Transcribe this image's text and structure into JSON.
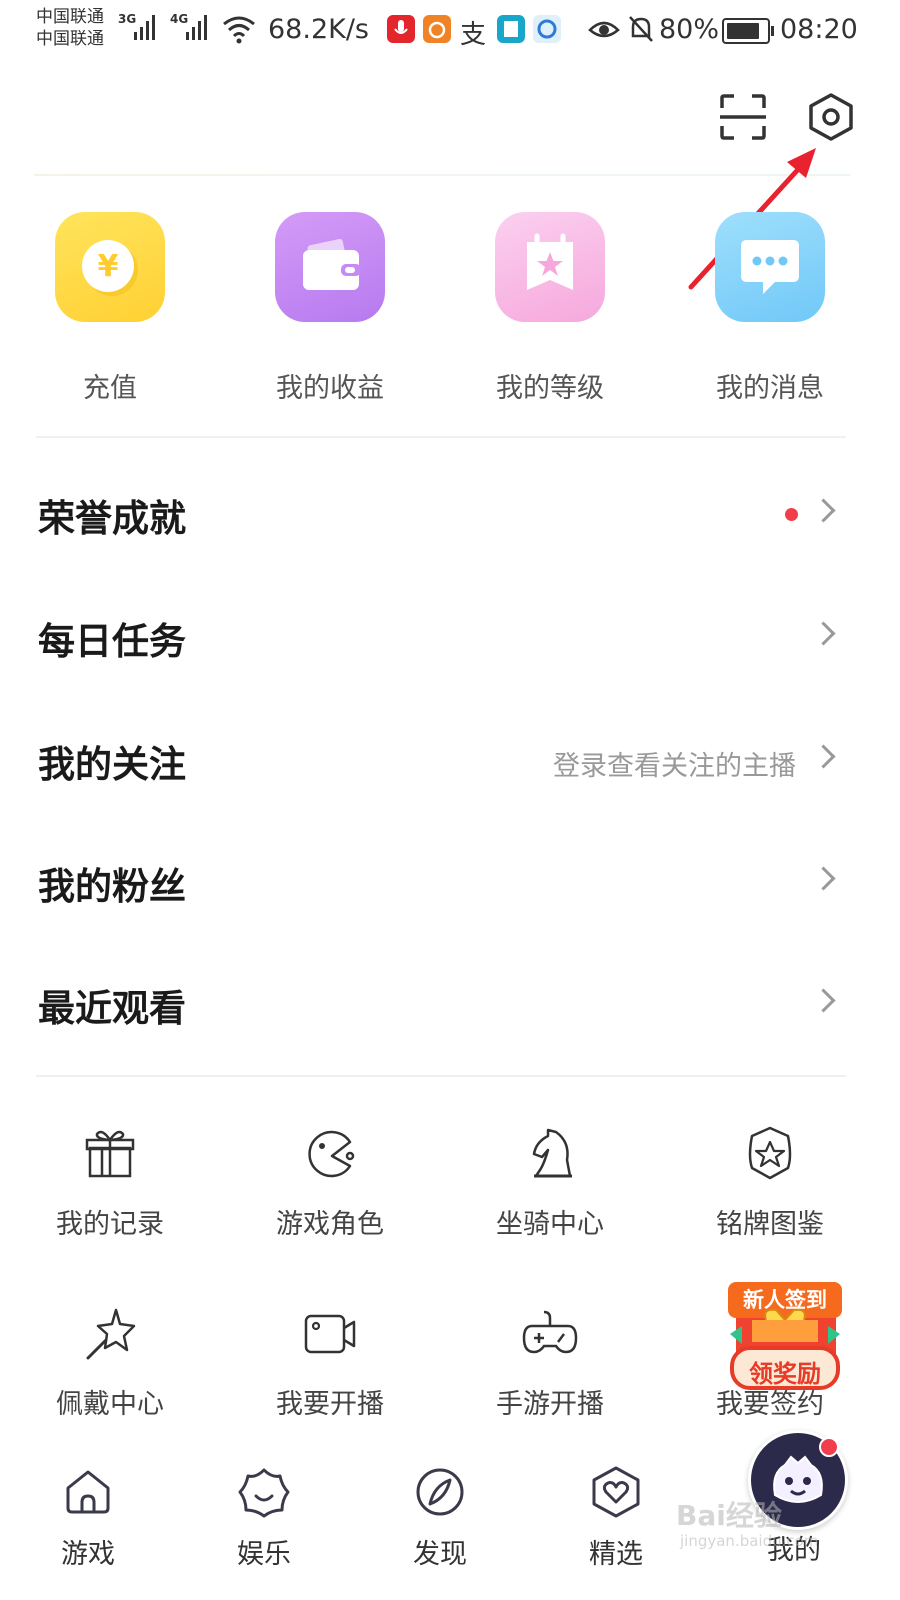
{
  "status_bar": {
    "carrier_1": "中国联通",
    "carrier_2": "中国联通",
    "net_1": "3G",
    "net_2": "4G",
    "speed": "68.2K/s",
    "battery_level": 0.8,
    "battery_text": "80%",
    "time": "08:20",
    "zhi_glyph": "支"
  },
  "header": {
    "scan_icon": "scan-icon",
    "settings_icon": "settings-hexagon-icon",
    "annotation_color": "#e8232f"
  },
  "quick_actions": [
    {
      "label": "充值",
      "icon": "coin-yuan-icon",
      "color": "#ffd940",
      "glyph": "¥"
    },
    {
      "label": "我的收益",
      "icon": "wallet-icon",
      "color": "#c58af3"
    },
    {
      "label": "我的等级",
      "icon": "level-badge-icon",
      "color": "#f8b9e6"
    },
    {
      "label": "我的消息",
      "icon": "message-bubble-icon",
      "color": "#82d2fb"
    }
  ],
  "menu": [
    {
      "title": "荣誉成就",
      "hint": "",
      "has_dot": true
    },
    {
      "title": "每日任务",
      "hint": "",
      "has_dot": false
    },
    {
      "title": "我的关注",
      "hint": "登录查看关注的主播",
      "has_dot": false
    },
    {
      "title": "我的粉丝",
      "hint": "",
      "has_dot": false
    },
    {
      "title": "最近观看",
      "hint": "",
      "has_dot": false
    }
  ],
  "tools": [
    {
      "label": "我的记录",
      "icon": "gift-icon"
    },
    {
      "label": "游戏角色",
      "icon": "pacman-icon"
    },
    {
      "label": "坐骑中心",
      "icon": "chess-knight-icon"
    },
    {
      "label": "铭牌图鉴",
      "icon": "shield-star-icon"
    },
    {
      "label": "佩戴中心",
      "icon": "star-wand-icon"
    },
    {
      "label": "我要开播",
      "icon": "video-camera-icon"
    },
    {
      "label": "手游开播",
      "icon": "gamepad-icon"
    },
    {
      "label": "我要签约",
      "icon": "sign-contract-icon"
    }
  ],
  "promo": {
    "line1": "新人签到",
    "line2": "领奖励"
  },
  "nav": [
    {
      "label": "游戏",
      "icon": "home-icon"
    },
    {
      "label": "娱乐",
      "icon": "flower-icon"
    },
    {
      "label": "发现",
      "icon": "compass-icon"
    },
    {
      "label": "精选",
      "icon": "heart-shield-icon"
    },
    {
      "label": "我的",
      "icon": "avatar-icon"
    }
  ],
  "watermark": {
    "brand": "Bai经验",
    "url": "jingyan.baidu.com"
  }
}
